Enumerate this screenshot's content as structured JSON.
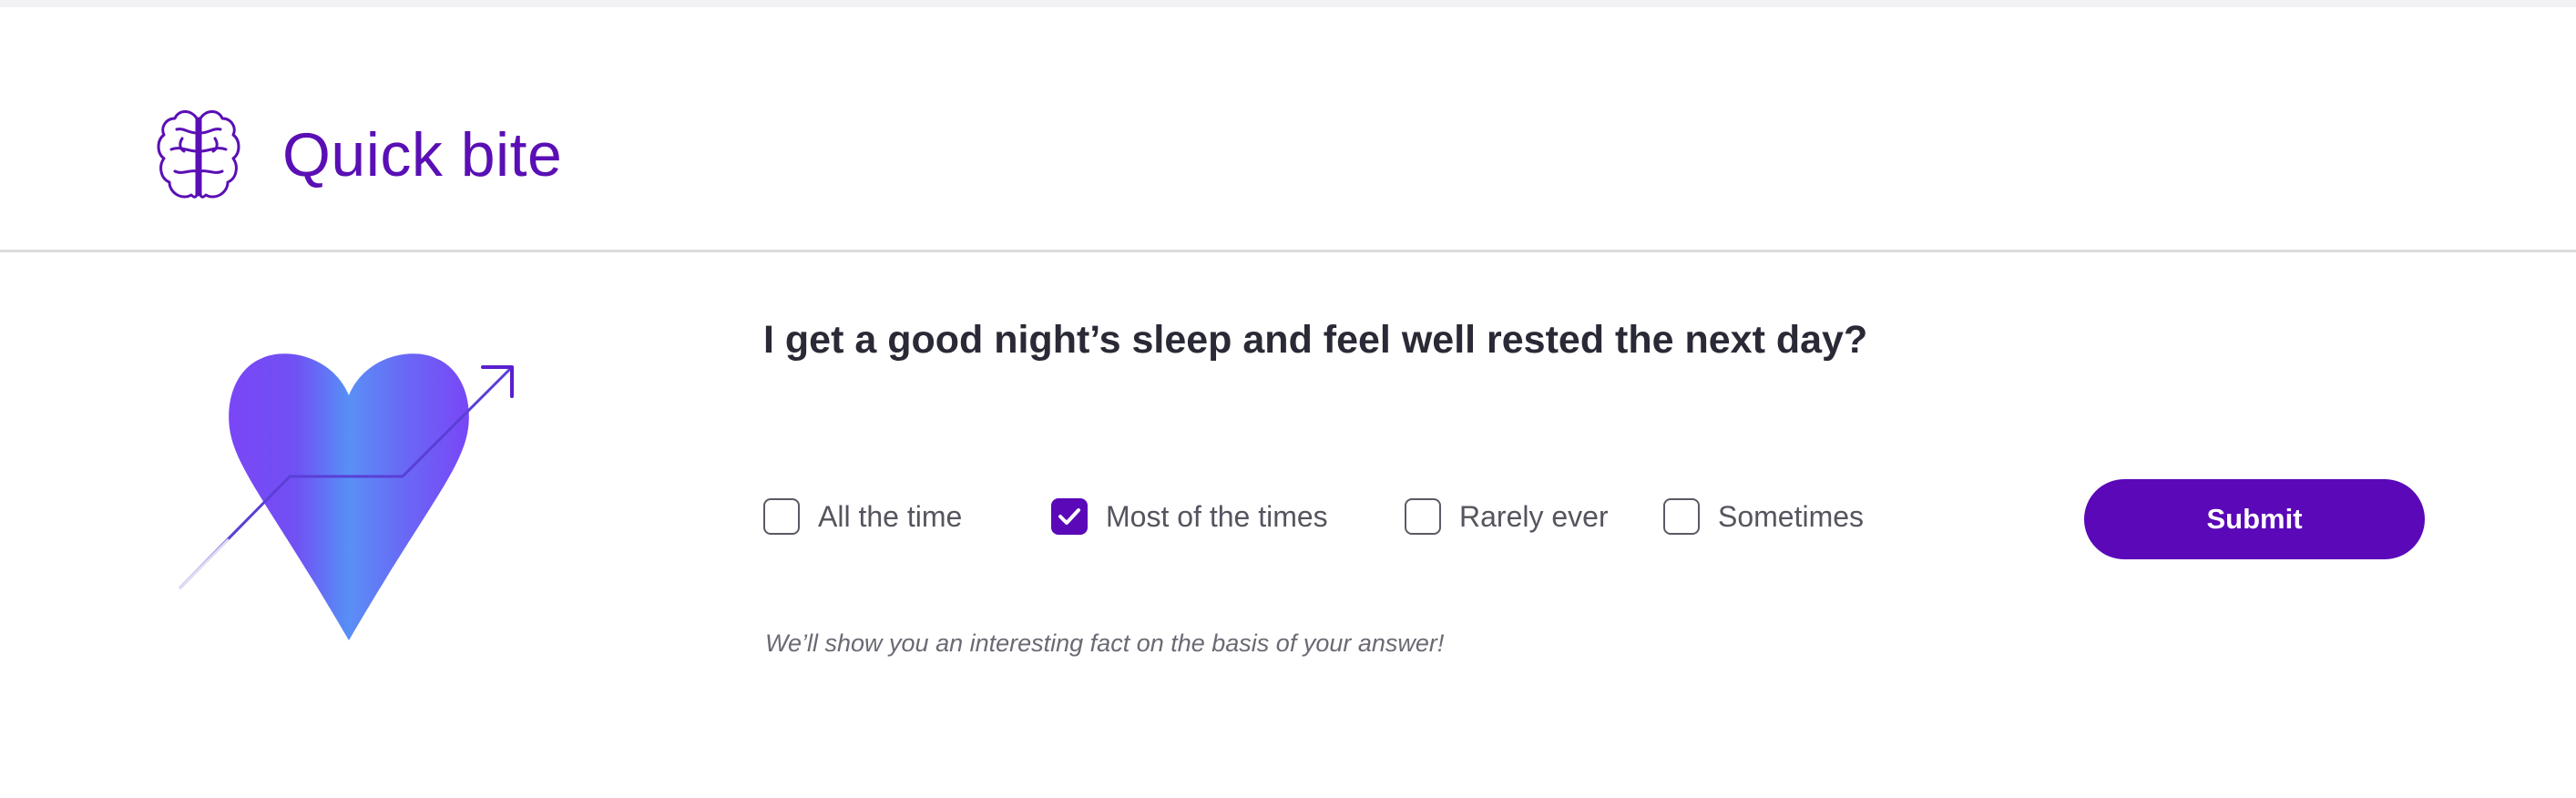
{
  "header": {
    "title": "Quick bite",
    "logo_icon": "brain-icon"
  },
  "illustration": {
    "icon": "heart-with-rising-arrow-icon"
  },
  "question": {
    "text": "I get a good night’s sleep and feel well rested the next day?"
  },
  "options": [
    {
      "label": "All the time",
      "checked": false
    },
    {
      "label": "Most of the times",
      "checked": true
    },
    {
      "label": "Rarely ever",
      "checked": false
    },
    {
      "label": "Sometimes",
      "checked": false
    }
  ],
  "submit": {
    "label": "Submit"
  },
  "hint": {
    "text": "We’ll show you an interesting fact on the basis of your answer!"
  },
  "colors": {
    "brand": "#5a0fb5",
    "accent": "#5b08b8",
    "question_text": "#2a2a36",
    "option_text": "#55555f",
    "hint_text": "#6a6a74",
    "heart_purple": "#7b47f5",
    "heart_blue": "#5a92f6"
  }
}
